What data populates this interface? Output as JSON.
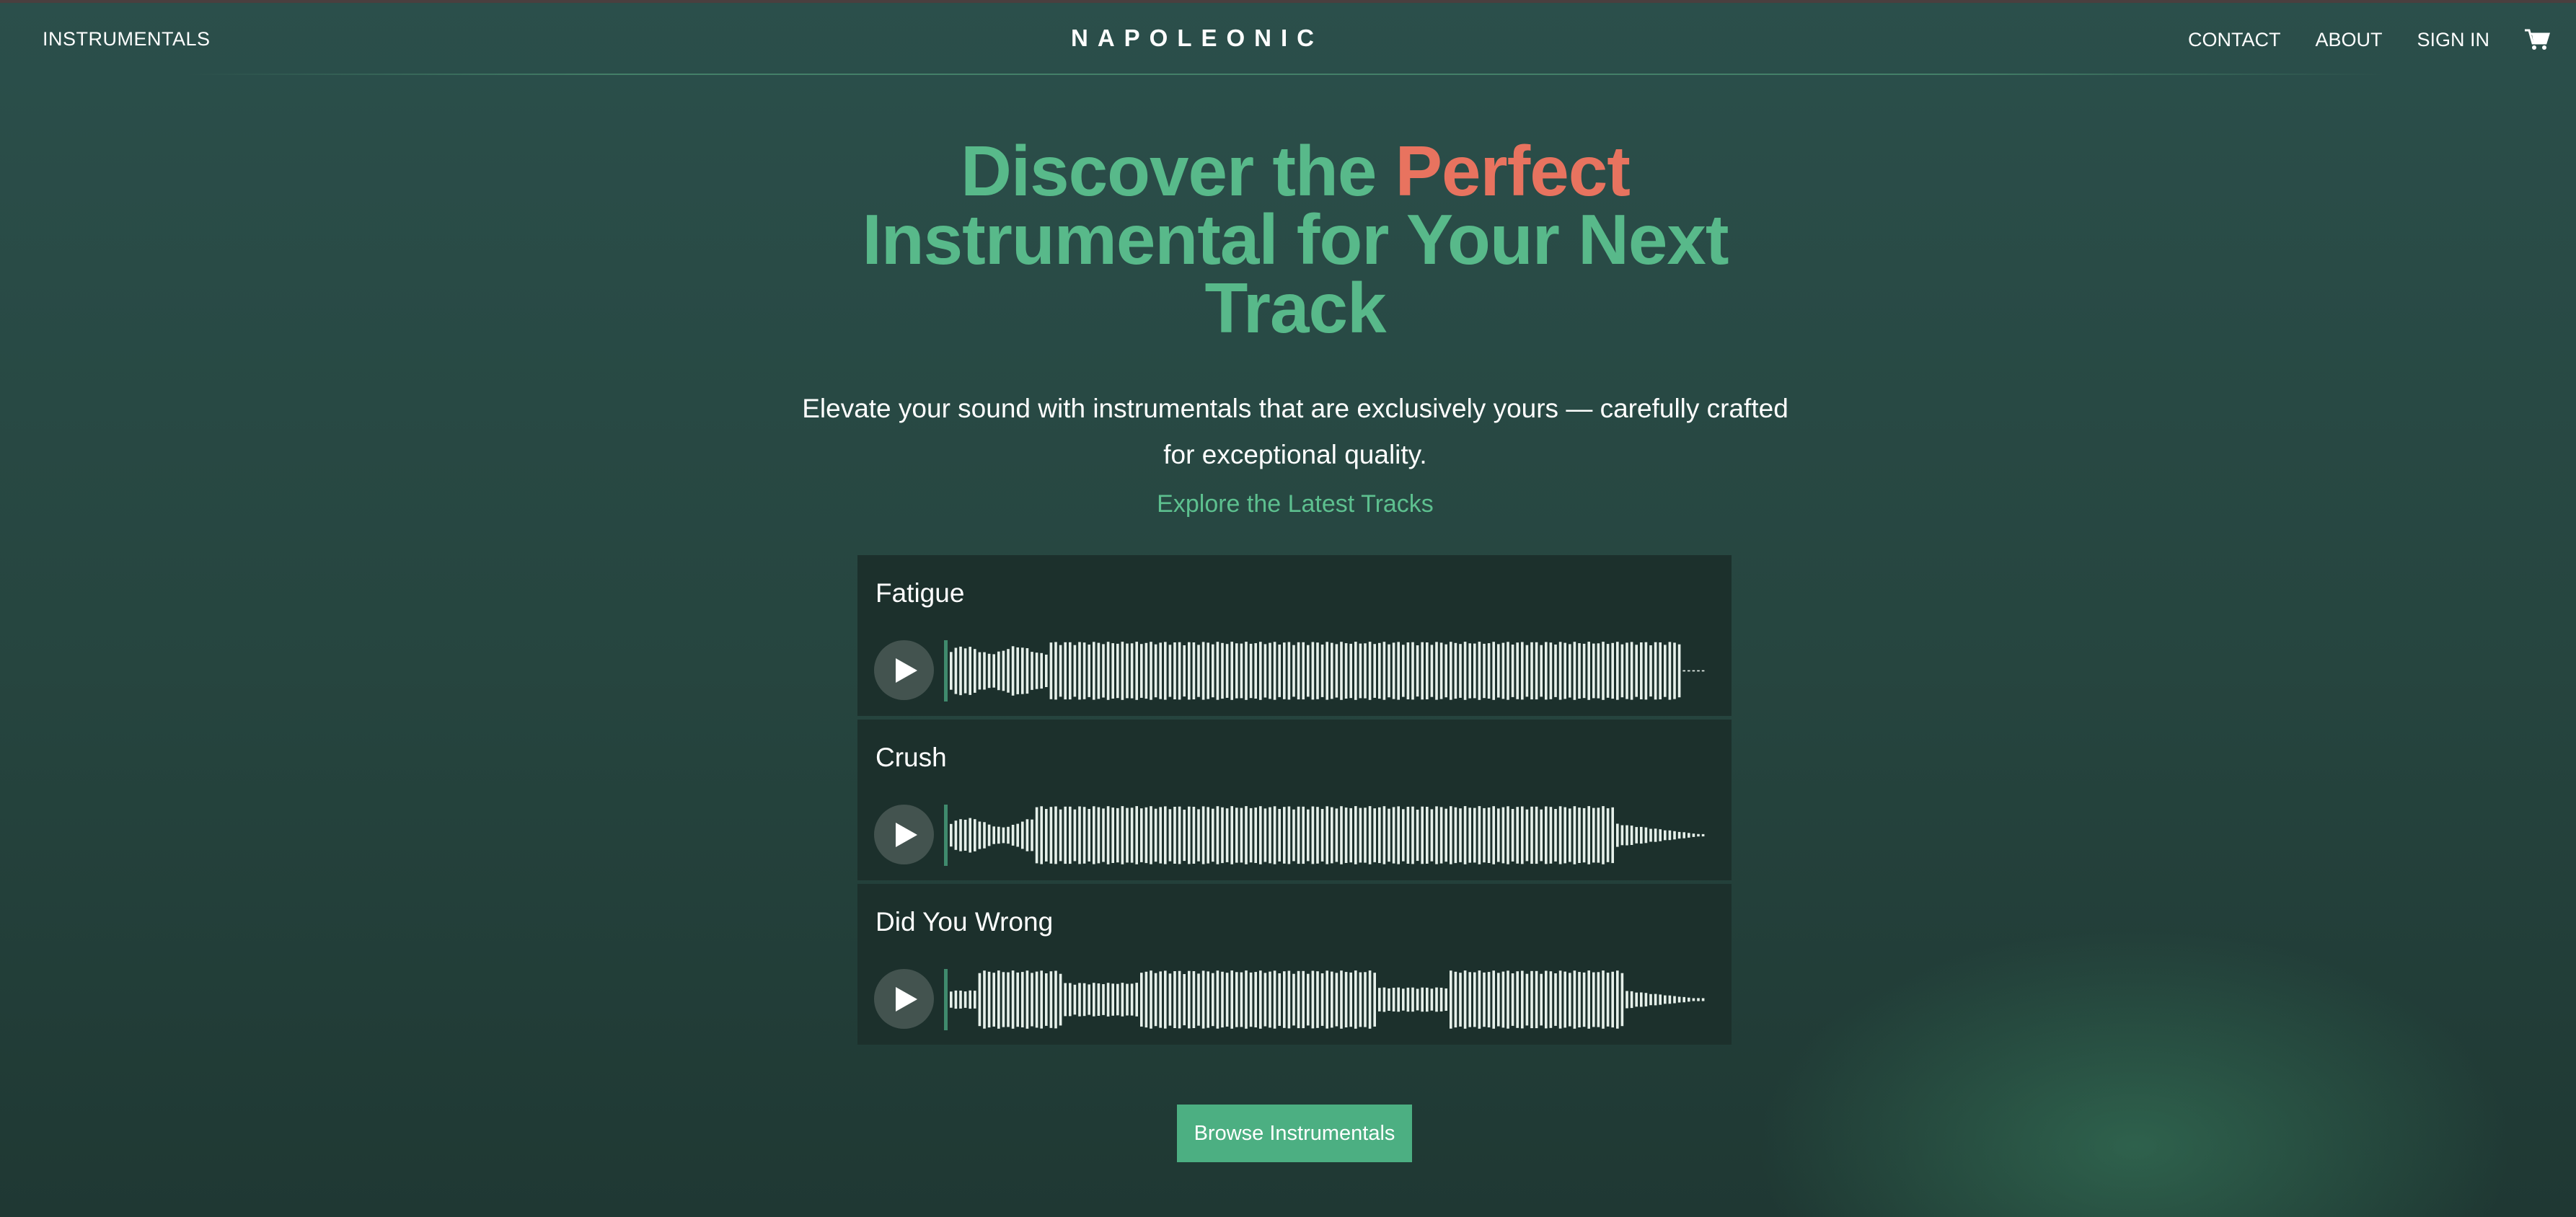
{
  "nav": {
    "left_link": "INSTRUMENTALS",
    "brand": "NAPOLEONIC",
    "links": [
      "CONTACT",
      "ABOUT",
      "SIGN IN"
    ],
    "cart_icon": "cart-icon"
  },
  "hero": {
    "title_part1": "Discover the ",
    "title_accent": "Perfect",
    "title_part2": "Instrumental for Your Next Track",
    "subtitle": "Elevate your sound with instrumentals that are exclusively yours — carefully crafted for exceptional quality.",
    "explore_label": "Explore the Latest Tracks"
  },
  "tracks": [
    {
      "title": "Fatigue",
      "played_fraction": 0
    },
    {
      "title": "Crush",
      "played_fraction": 0
    },
    {
      "title": "Did You Wrong",
      "played_fraction": 0
    }
  ],
  "cta": {
    "browse_label": "Browse Instrumentals"
  },
  "colors": {
    "accent_green": "#58b98a",
    "accent_coral": "#e8735f",
    "button_green": "#4caf82",
    "waveform": "#e6f0ea",
    "panel": "#1c302c"
  }
}
